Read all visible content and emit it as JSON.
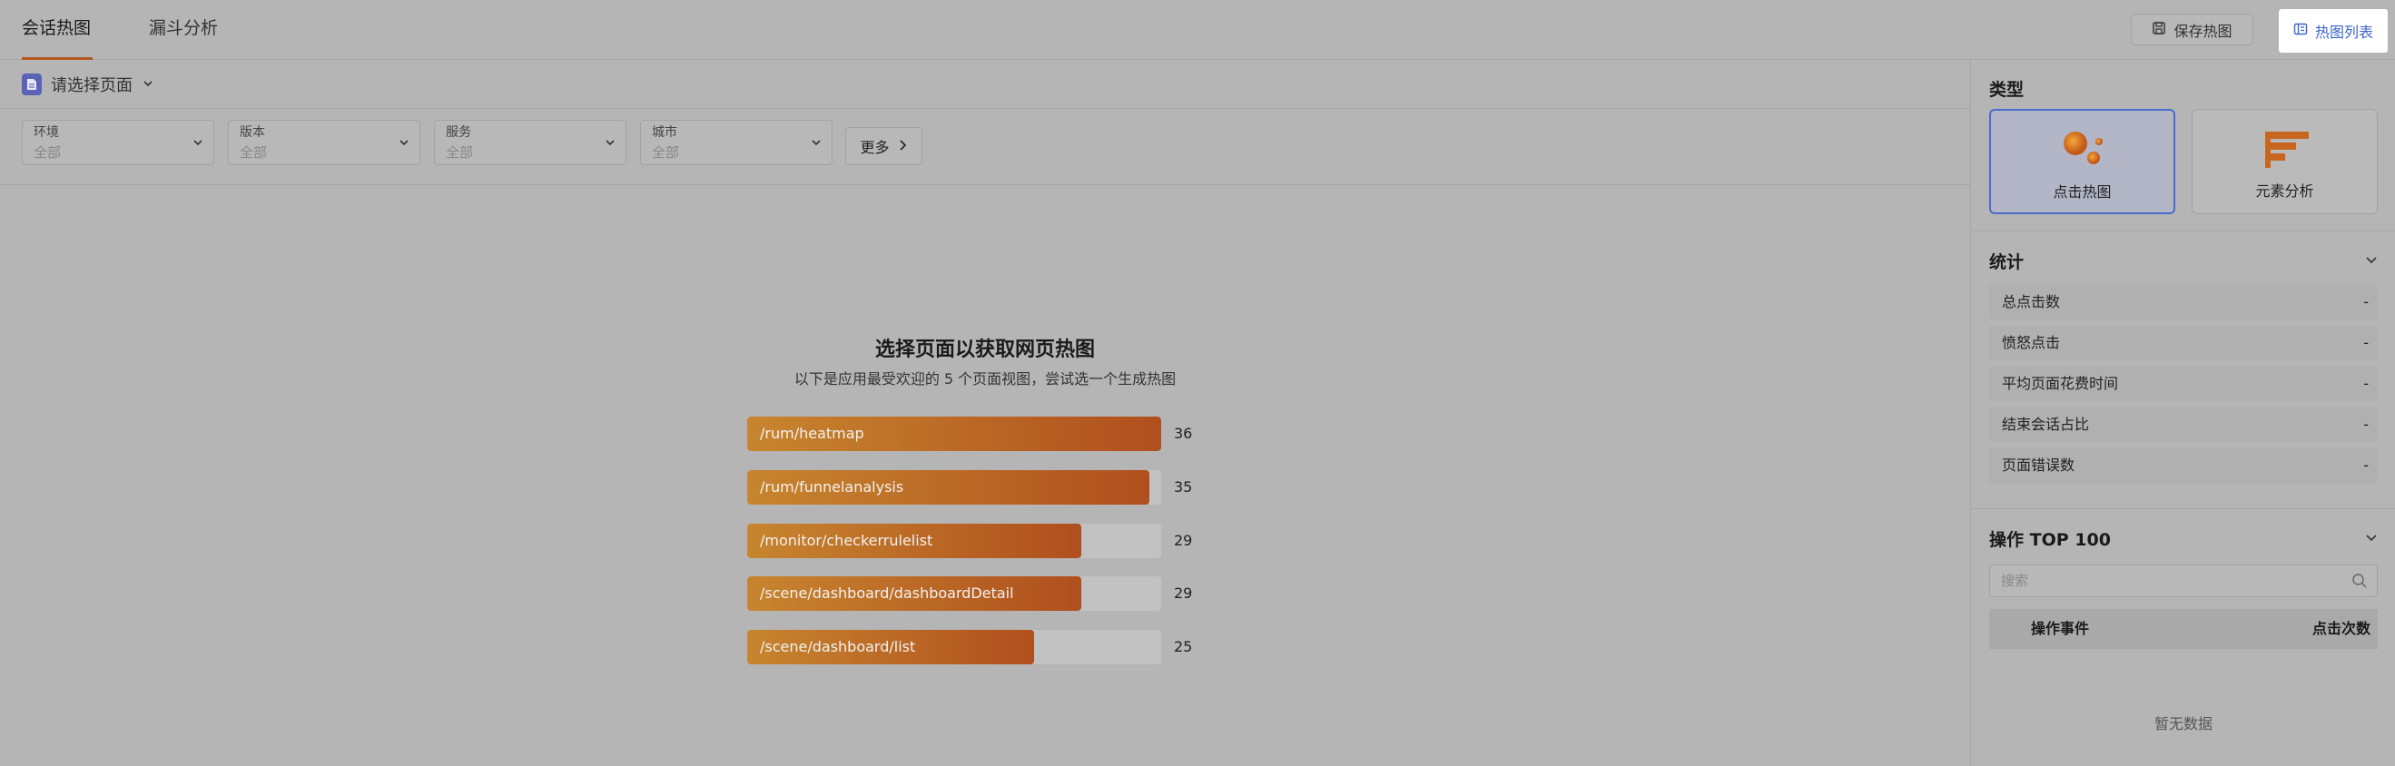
{
  "tabs": [
    {
      "label": "会话热图",
      "active": true
    },
    {
      "label": "漏斗分析",
      "active": false
    }
  ],
  "toolbar": {
    "save_label": "保存热图",
    "list_label": "热图列表"
  },
  "page_select": {
    "placeholder": "请选择页面",
    "icon": "document-icon"
  },
  "filters": [
    {
      "label": "环境",
      "value": "全部"
    },
    {
      "label": "版本",
      "value": "全部"
    },
    {
      "label": "服务",
      "value": "全部"
    },
    {
      "label": "城市",
      "value": "全部"
    }
  ],
  "more_label": "更多",
  "empty_state": {
    "title": "选择页面以获取网页热图",
    "subtitle": "以下是应用最受欢迎的 5 个页面视图，尝试选一个生成热图"
  },
  "top_pages": [
    {
      "path": "/rum/heatmap",
      "count": "36",
      "fraction": 1.0
    },
    {
      "path": "/rum/funnelanalysis",
      "count": "35",
      "fraction": 0.972
    },
    {
      "path": "/monitor/checkerrulelist",
      "count": "29",
      "fraction": 0.806
    },
    {
      "path": "/scene/dashboard/dashboardDetail",
      "count": "29",
      "fraction": 0.806
    },
    {
      "path": "/scene/dashboard/list",
      "count": "25",
      "fraction": 0.694
    }
  ],
  "panel": {
    "type_title": "类型",
    "types": [
      {
        "label": "点击热图",
        "icon": "click-heatmap-icon",
        "selected": true
      },
      {
        "label": "元素分析",
        "icon": "element-analysis-icon",
        "selected": false
      }
    ],
    "stats_title": "统计",
    "stats": [
      {
        "name": "总点击数",
        "value": "-"
      },
      {
        "name": "愤怒点击",
        "value": "-"
      },
      {
        "name": "平均页面花费时间",
        "value": "-"
      },
      {
        "name": "结束会话占比",
        "value": "-"
      },
      {
        "name": "页面错误数",
        "value": "-"
      }
    ],
    "ops_title": "操作 TOP 100",
    "search_placeholder": "搜索",
    "columns": [
      "操作事件",
      "点击次数"
    ],
    "empty_text": "暂无数据"
  },
  "colors": {
    "accent": "#b5561c",
    "bar_start": "#c7852e",
    "bar_end": "#b04f1e",
    "link_blue": "#3b63c7",
    "overlay_gray": "#b5b5b5"
  }
}
